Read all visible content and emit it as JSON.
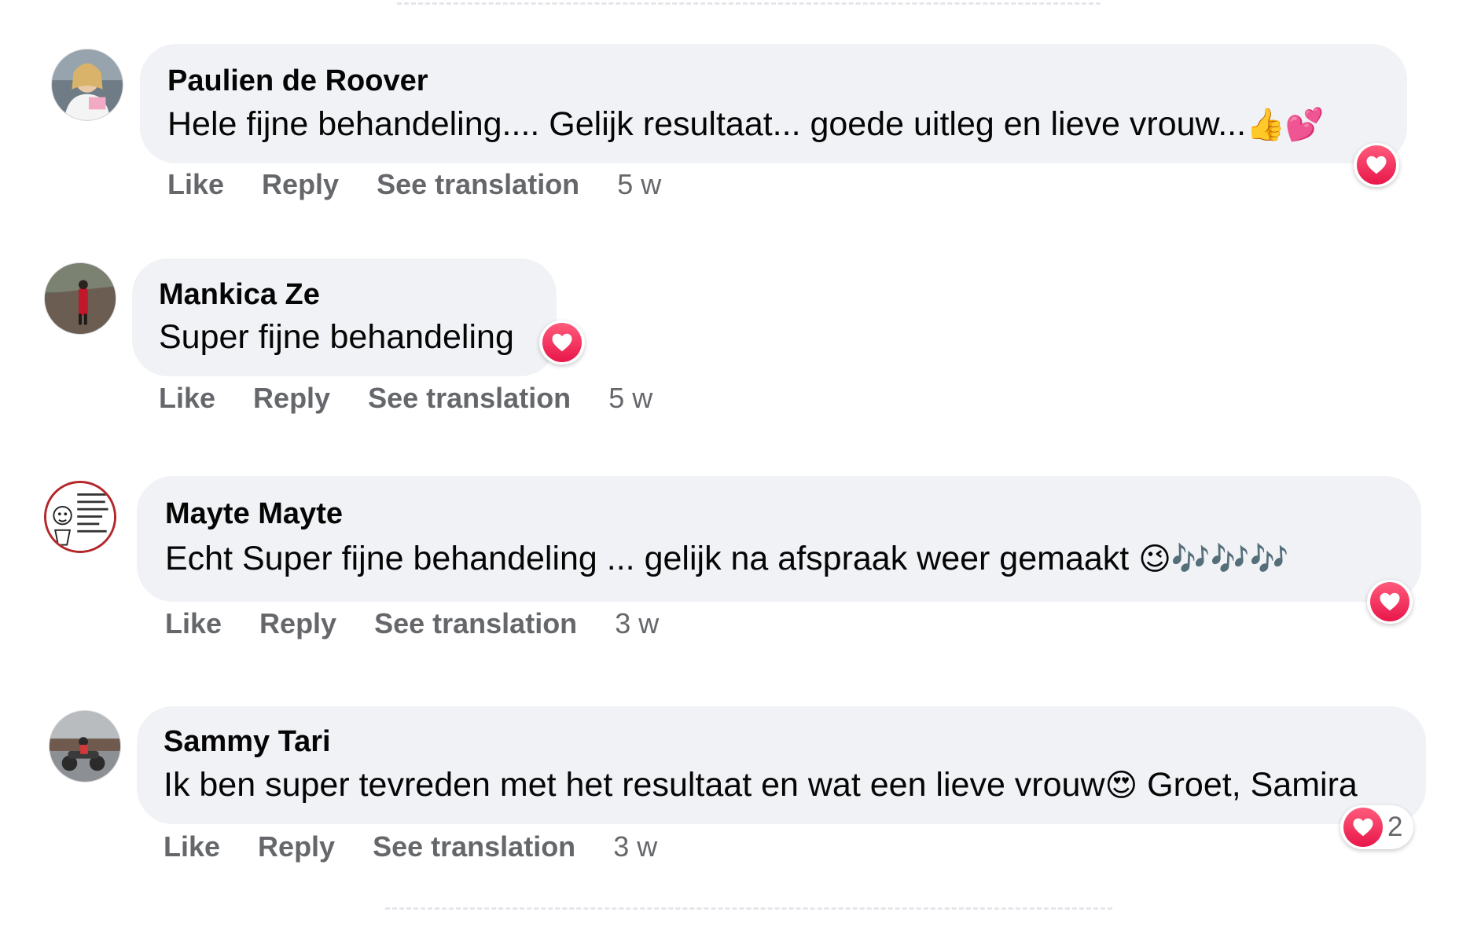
{
  "comments": [
    {
      "author": "Paulien de Roover",
      "text": "Hele fijne behandeling.... Gelijk resultaat... goede uitleg en lieve vrouw...",
      "emoji": "👍💕",
      "actions": {
        "like": "Like",
        "reply": "Reply",
        "translate": "See translation"
      },
      "time": "5 w",
      "reaction": {
        "icon": "heart-icon",
        "count": ""
      }
    },
    {
      "author": "Mankica Ze",
      "text": "Super fijne behandeling",
      "emoji": "",
      "actions": {
        "like": "Like",
        "reply": "Reply",
        "translate": "See translation"
      },
      "time": "5 w",
      "reaction": {
        "icon": "heart-icon",
        "count": ""
      }
    },
    {
      "author": "Mayte Mayte",
      "text": "Echt Super fijne behandeling ... gelijk na afspraak weer gemaakt ",
      "emoji": "😉🎶🎶🎶",
      "actions": {
        "like": "Like",
        "reply": "Reply",
        "translate": "See translation"
      },
      "time": "3 w",
      "reaction": {
        "icon": "heart-icon",
        "count": ""
      }
    },
    {
      "author": "Sammy Tari",
      "text": "Ik ben super tevreden met het resultaat en wat een lieve vrouw",
      "emoji": "😍",
      "text_after": " Groet, Samira",
      "actions": {
        "like": "Like",
        "reply": "Reply",
        "translate": "See translation"
      },
      "time": "3 w",
      "reaction": {
        "icon": "heart-icon",
        "count": "2"
      }
    }
  ],
  "colors": {
    "bubble": "#f0f2f5",
    "meta_text": "#65676b",
    "love_reaction": "#f33e58"
  }
}
